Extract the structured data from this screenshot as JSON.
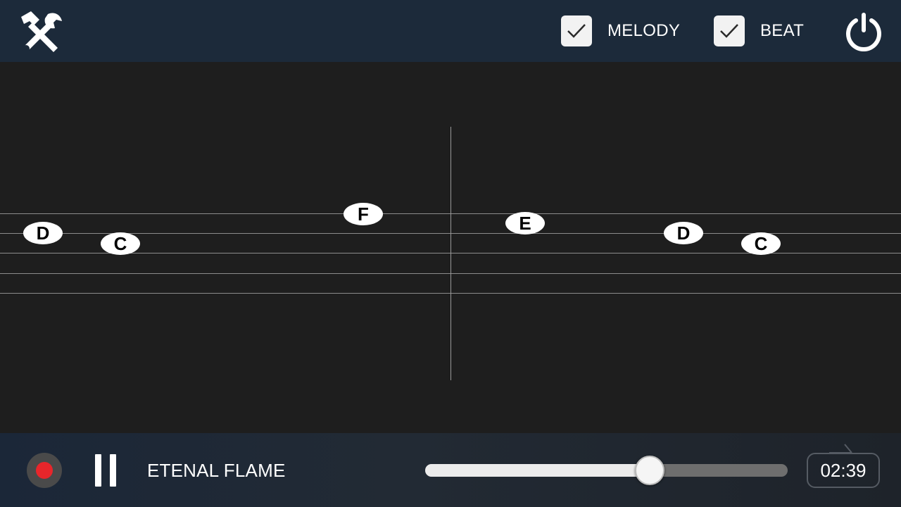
{
  "header": {
    "tools_icon": "wrench-hammer-icon",
    "melody": {
      "label": "MELODY",
      "checked": true
    },
    "beat": {
      "label": "BEAT",
      "checked": true
    },
    "power_icon": "power-icon"
  },
  "staff": {
    "notes": [
      {
        "id": "D",
        "label": "D"
      },
      {
        "id": "C",
        "label": "C"
      },
      {
        "id": "F",
        "label": "F"
      },
      {
        "id": "E",
        "label": "E"
      },
      {
        "id": "D2",
        "label": "D"
      },
      {
        "id": "C2",
        "label": "C"
      }
    ]
  },
  "player": {
    "record_icon": "record-icon",
    "pause_icon": "pause-icon",
    "song_title": "ETENAL FLAME",
    "progress": 0.62,
    "time": "02:39",
    "loop_icon": "loop-icon"
  },
  "colors": {
    "topbar": "#1c2a3a",
    "background": "#1e1e1e",
    "record": "#e8262b",
    "note": "#ffffff"
  }
}
